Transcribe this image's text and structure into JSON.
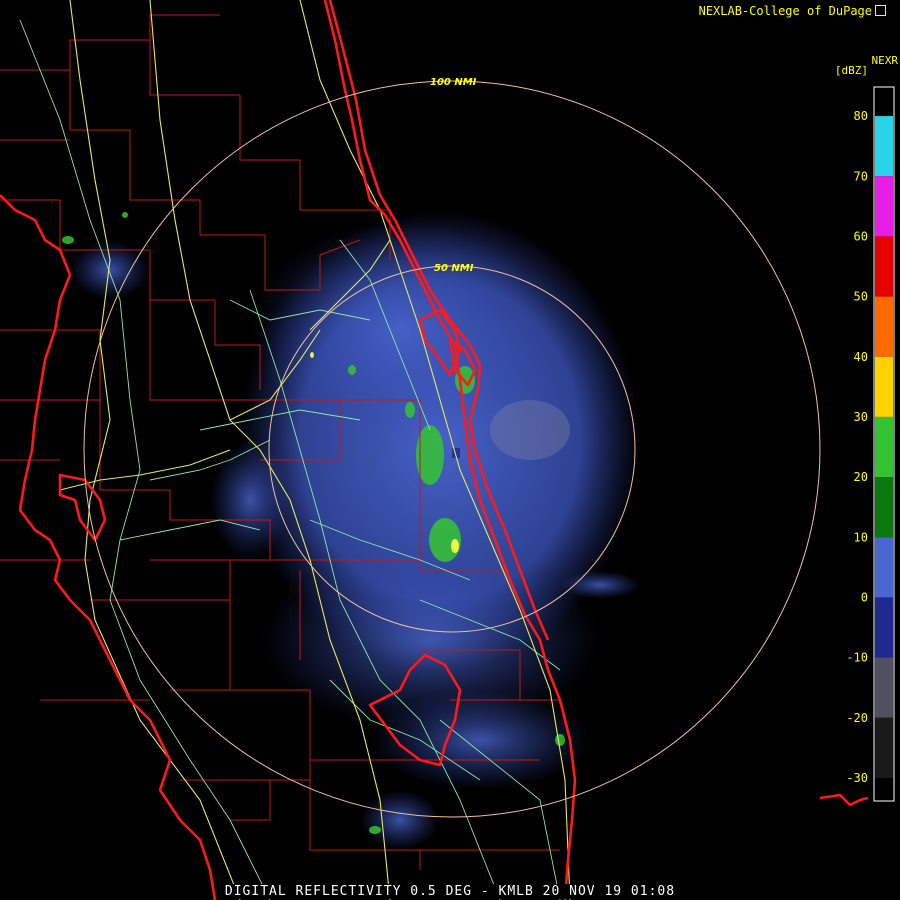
{
  "header": {
    "credit": "NEXLAB-College of DuPage",
    "product": "NEXR",
    "units": "[dBZ]"
  },
  "footer": {
    "caption": "DIGITAL REFLECTIVITY 0.5 DEG - KMLB 20 NOV 19 01:08"
  },
  "range_rings": [
    {
      "label": "50 NMI",
      "nmi": 50
    },
    {
      "label": "100 NMI",
      "nmi": 100
    }
  ],
  "color_scale": {
    "ticks": [
      "80",
      "70",
      "60",
      "50",
      "40",
      "30",
      "20",
      "10",
      "0",
      "-10",
      "-20",
      "-30"
    ],
    "bands": [
      {
        "from": 70,
        "to": 80,
        "color": "#2ad4e8"
      },
      {
        "from": 60,
        "to": 70,
        "color": "#e61ee6"
      },
      {
        "from": 50,
        "to": 60,
        "color": "#e60000"
      },
      {
        "from": 40,
        "to": 50,
        "color": "#ff6a00"
      },
      {
        "from": 30,
        "to": 40,
        "color": "#ffd200"
      },
      {
        "from": 20,
        "to": 30,
        "color": "#35c431"
      },
      {
        "from": 10,
        "to": 20,
        "color": "#0a7a10"
      },
      {
        "from": 0,
        "to": 10,
        "color": "#4a66d0"
      },
      {
        "from": -10,
        "to": 0,
        "color": "#1e2a90"
      },
      {
        "from": -20,
        "to": -10,
        "color": "#505060"
      },
      {
        "from": -30,
        "to": -20,
        "color": "#1a1a1a"
      }
    ]
  },
  "colors": {
    "coastline": "#ff1a1a",
    "county_borders": "#c01818",
    "highways": "#e8e860",
    "roads": "#8ce8a8",
    "range_ring": "#f0c0a0",
    "echo_weak": "#4a66d0",
    "echo_moderate": "#35c431",
    "echo_strong": "#ffff40",
    "label_text": "#ffff00"
  }
}
